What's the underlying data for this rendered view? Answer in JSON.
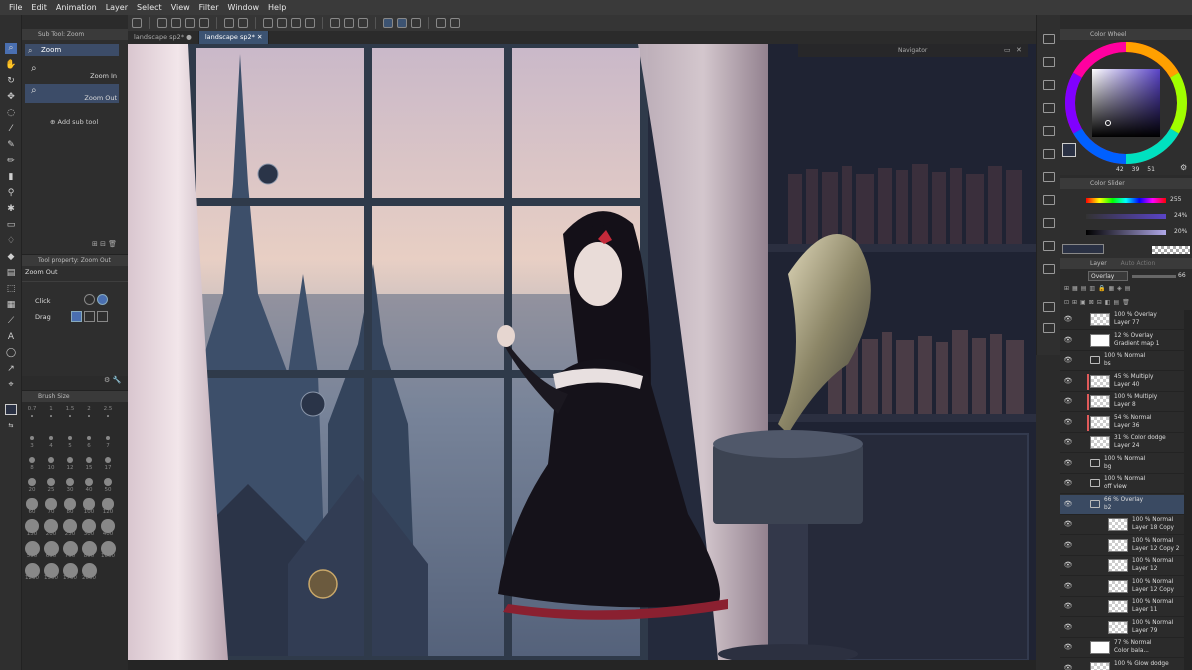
{
  "menu": [
    "File",
    "Edit",
    "Animation",
    "Layer",
    "Select",
    "View",
    "Filter",
    "Window",
    "Help"
  ],
  "tabs": [
    {
      "label": "landscape sp2*",
      "active": false
    },
    {
      "label": "landscape sp2*",
      "active": true
    }
  ],
  "subtool": {
    "title": "Sub Tool: Zoom",
    "active_group": "Zoom",
    "zoom_in": "Zoom In",
    "zoom_out": "Zoom Out",
    "add_sub_tool": "Add sub tool"
  },
  "toolprop": {
    "title": "Tool property: Zoom Out",
    "tool_name": "Zoom Out",
    "click_label": "Click",
    "drag_label": "Drag"
  },
  "brushsize": {
    "title": "Brush Size",
    "sizes": [
      "0.7",
      "1",
      "1.5",
      "2",
      "2.5",
      "3",
      "4",
      "5",
      "6",
      "7",
      "8",
      "10",
      "12",
      "15",
      "17",
      "20",
      "25",
      "30",
      "40",
      "50",
      "60",
      "70",
      "80",
      "100",
      "120",
      "150",
      "200",
      "250",
      "300",
      "400",
      "500",
      "600",
      "700",
      "800",
      "1000",
      "1200",
      "1500",
      "1700",
      "2000"
    ]
  },
  "navigator": {
    "title": "Navigator"
  },
  "colorwheel": {
    "title": "Color Wheel",
    "values": [
      "42",
      "39",
      "51"
    ]
  },
  "colorslider": {
    "title": "Color Slider",
    "h_value": "255",
    "s_value": "24%",
    "v_value": "20%"
  },
  "layer": {
    "title": "Layer",
    "tab2": "Auto Action",
    "blend_mode": "Overlay",
    "opacity": "66",
    "rows": [
      {
        "mode": "100 % Overlay",
        "name": "Layer 77",
        "type": "layer"
      },
      {
        "mode": "12 % Overlay",
        "name": "Gradient map 1",
        "type": "correction"
      },
      {
        "mode": "100 % Normal",
        "name": "bs",
        "type": "folder"
      },
      {
        "mode": "45 % Multiply",
        "name": "Layer 40",
        "type": "layer"
      },
      {
        "mode": "100 % Multiply",
        "name": "Layer 8",
        "type": "layer"
      },
      {
        "mode": "54 % Normal",
        "name": "Layer 36",
        "type": "layer"
      },
      {
        "mode": "31 % Color dodge",
        "name": "Layer 24",
        "type": "layer"
      },
      {
        "mode": "100 % Normal",
        "name": "bg",
        "type": "folder"
      },
      {
        "mode": "100 % Normal",
        "name": "off view",
        "type": "folder"
      },
      {
        "mode": "66 % Overlay",
        "name": "b2",
        "type": "folder",
        "selected": true
      },
      {
        "mode": "100 % Normal",
        "name": "Layer 18 Copy",
        "type": "layer"
      },
      {
        "mode": "100 % Normal",
        "name": "Layer 12 Copy 2",
        "type": "layer"
      },
      {
        "mode": "100 % Normal",
        "name": "Layer 12",
        "type": "layer"
      },
      {
        "mode": "100 % Normal",
        "name": "Layer 12 Copy",
        "type": "layer"
      },
      {
        "mode": "100 % Normal",
        "name": "Layer 11",
        "type": "layer"
      },
      {
        "mode": "100 % Normal",
        "name": "Layer 79",
        "type": "layer"
      },
      {
        "mode": "77 % Normal",
        "name": "Color bala...",
        "type": "correction"
      },
      {
        "mode": "100 % Glow dodge",
        "name": "",
        "type": "layer"
      }
    ]
  },
  "colors": {
    "accent": "#4a6fb0",
    "selected_layer": "#3a4a62",
    "panel": "#2e2e2e"
  }
}
